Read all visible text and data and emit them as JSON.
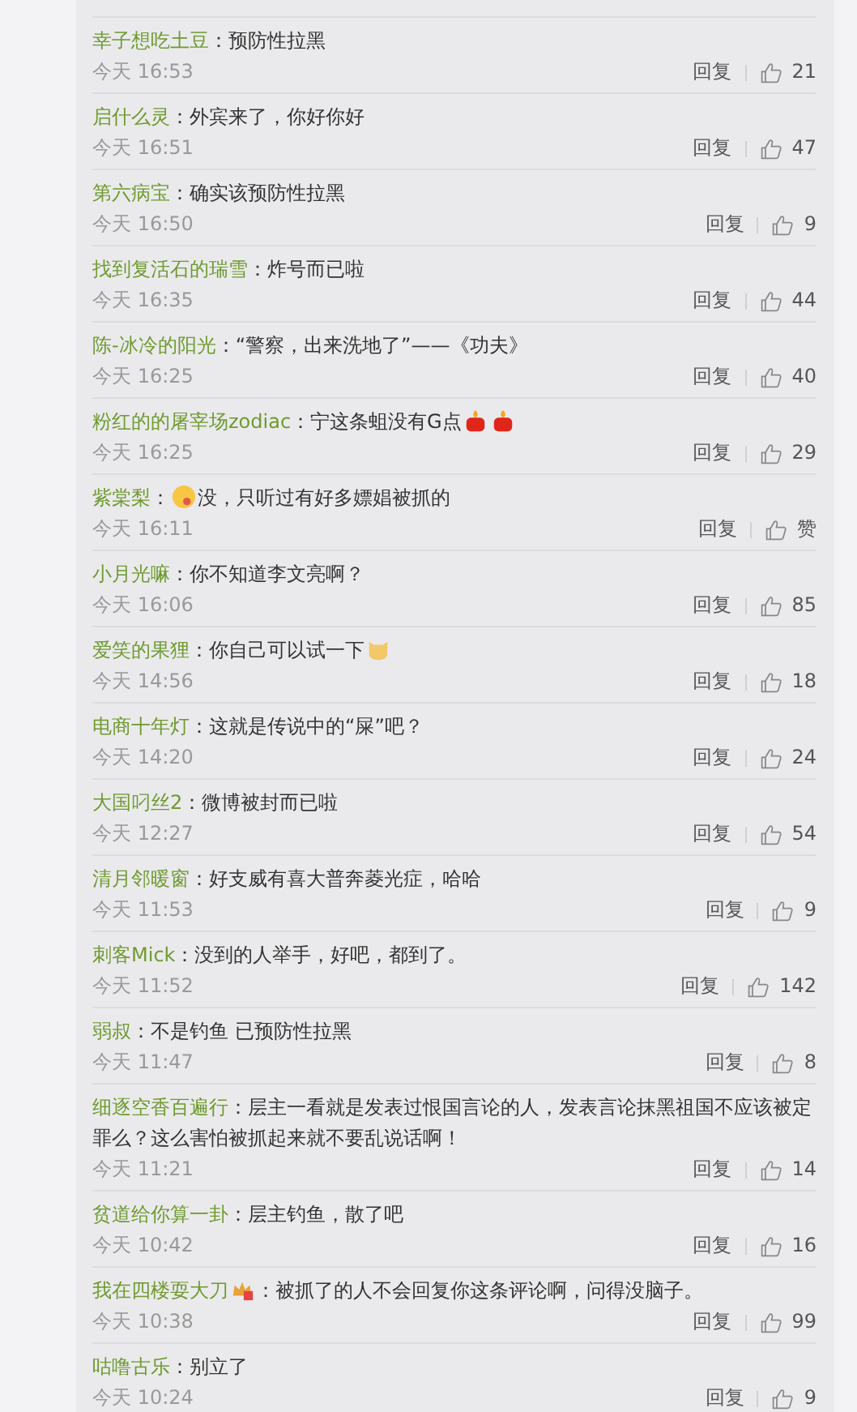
{
  "comments": [
    {
      "user": "幸子想吃土豆",
      "parts": [
        {
          "kind": "text",
          "text": "：预防性拉黑"
        }
      ],
      "time": "今天 16:53",
      "reply": "回复",
      "likes": "21"
    },
    {
      "user": "启什么灵",
      "parts": [
        {
          "kind": "text",
          "text": "：外宾来了，你好你好"
        }
      ],
      "time": "今天 16:51",
      "reply": "回复",
      "likes": "47"
    },
    {
      "user": "第六病宝",
      "parts": [
        {
          "kind": "text",
          "text": "：确实该预防性拉黑"
        }
      ],
      "time": "今天 16:50",
      "reply": "回复",
      "likes": "9"
    },
    {
      "user": "找到复活石的瑞雪",
      "parts": [
        {
          "kind": "text",
          "text": "：炸号而已啦"
        }
      ],
      "time": "今天 16:35",
      "reply": "回复",
      "likes": "44"
    },
    {
      "user": "陈-冰冷的阳光",
      "parts": [
        {
          "kind": "text",
          "text": "：“警察，出来洗地了”——《功夫》"
        }
      ],
      "time": "今天 16:25",
      "reply": "回复",
      "likes": "40"
    },
    {
      "user": "粉红的的屠宰场zodiac",
      "parts": [
        {
          "kind": "text",
          "text": "：宁这条蛆没有G点"
        },
        {
          "kind": "candle"
        },
        {
          "kind": "candle"
        }
      ],
      "time": "今天 16:25",
      "reply": "回复",
      "likes": "29"
    },
    {
      "user": "紫棠梨",
      "parts": [
        {
          "kind": "text",
          "text": "："
        },
        {
          "kind": "face"
        },
        {
          "kind": "text",
          "text": "没，只听过有好多嫖娼被抓的"
        }
      ],
      "time": "今天 16:11",
      "reply": "回复",
      "likes": "赞"
    },
    {
      "user": "小月光嘛",
      "parts": [
        {
          "kind": "text",
          "text": "：你不知道李文亮啊？"
        }
      ],
      "time": "今天 16:06",
      "reply": "回复",
      "likes": "85"
    },
    {
      "user": "爱笑的果狸",
      "parts": [
        {
          "kind": "text",
          "text": "：你自己可以试一下"
        },
        {
          "kind": "cat"
        }
      ],
      "time": "今天 14:56",
      "reply": "回复",
      "likes": "18"
    },
    {
      "user": "电商十年灯",
      "parts": [
        {
          "kind": "text",
          "text": "：这就是传说中的“屎”吧？"
        }
      ],
      "time": "今天 14:20",
      "reply": "回复",
      "likes": "24"
    },
    {
      "user": "大国叼丝2",
      "parts": [
        {
          "kind": "text",
          "text": "：微博被封而已啦"
        }
      ],
      "time": "今天 12:27",
      "reply": "回复",
      "likes": "54"
    },
    {
      "user": "清月邻暖窗",
      "parts": [
        {
          "kind": "text",
          "text": "：好支威有喜大普奔菱光症，哈哈"
        }
      ],
      "time": "今天 11:53",
      "reply": "回复",
      "likes": "9"
    },
    {
      "user": "刺客Mick",
      "parts": [
        {
          "kind": "text",
          "text": "：没到的人举手，好吧，都到了。"
        }
      ],
      "time": "今天 11:52",
      "reply": "回复",
      "likes": "142"
    },
    {
      "user": "弱叔",
      "parts": [
        {
          "kind": "text",
          "text": "：不是钓鱼 已预防性拉黑"
        }
      ],
      "time": "今天 11:47",
      "reply": "回复",
      "likes": "8"
    },
    {
      "user": "细逐空香百遍行",
      "parts": [
        {
          "kind": "text",
          "text": "：层主一看就是发表过恨国言论的人，发表言论抹黑祖国不应该被定罪么？这么害怕被抓起来就不要乱说话啊！"
        }
      ],
      "time": "今天 11:21",
      "reply": "回复",
      "likes": "14"
    },
    {
      "user": "贫道给你算一卦",
      "parts": [
        {
          "kind": "text",
          "text": "：层主钓鱼，散了吧"
        }
      ],
      "time": "今天 10:42",
      "reply": "回复",
      "likes": "16"
    },
    {
      "user": "我在四楼耍大刀",
      "badge": true,
      "parts": [
        {
          "kind": "text",
          "text": "：被抓了的人不会回复你这条评论啊，问得没脑子。"
        }
      ],
      "time": "今天 10:38",
      "reply": "回复",
      "likes": "99"
    },
    {
      "user": "咕噜古乐",
      "parts": [
        {
          "kind": "text",
          "text": "：别立了"
        }
      ],
      "time": "今天 10:24",
      "reply": "回复",
      "likes": "9"
    }
  ]
}
